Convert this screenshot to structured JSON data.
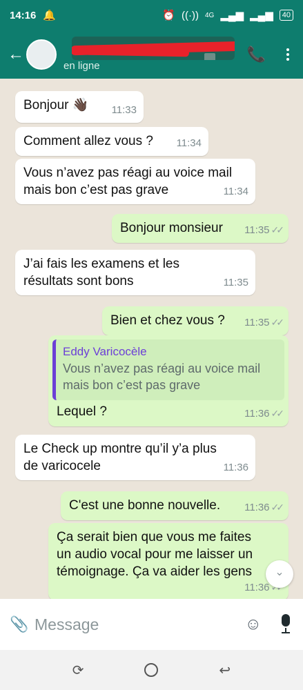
{
  "status_bar": {
    "time": "14:16",
    "notification_icon": "bell-icon",
    "network": "4G",
    "battery": "40"
  },
  "header": {
    "contact_name_visible": "en ligne",
    "contact_status": "en ligne",
    "back_icon": "arrow-left-icon",
    "call_icon": "phone-icon",
    "menu_icon": "kebab-icon"
  },
  "messages": [
    {
      "dir": "in",
      "text": "Bonjour 👋🏿",
      "time": "11:33"
    },
    {
      "dir": "in",
      "text": "Comment allez vous ?",
      "time": "11:34"
    },
    {
      "dir": "in",
      "line1": "Vous n’avez pas réagi au voice mail",
      "line2": "mais bon c’est pas grave",
      "time": "11:34"
    },
    {
      "dir": "out",
      "text": "Bonjour monsieur",
      "time": "11:35"
    },
    {
      "dir": "in",
      "line1": "J’ai fais les examens et les",
      "line2": "résultats sont bons",
      "time": "11:35"
    },
    {
      "dir": "out",
      "text": "Bien et chez vous ?",
      "time": "11:35"
    },
    {
      "dir": "out",
      "quote_author": "Eddy Varicocèle",
      "quote_line1": "Vous n’avez pas réagi au voice mail",
      "quote_line2": "mais bon c’est pas grave",
      "text": "Lequel ?",
      "time": "11:36"
    },
    {
      "dir": "in",
      "line1": "Le Check up montre qu’il y’a plus",
      "line2": "de varicocele",
      "time": "11:36"
    },
    {
      "dir": "out",
      "text": "C'est une bonne nouvelle.",
      "time": "11:36"
    },
    {
      "dir": "out",
      "line1": "Ça serait bien que vous me faites",
      "line2": "un audio vocal pour me laisser un",
      "line3": "témoignage. Ça va aider les gens",
      "time": "11:36"
    }
  ],
  "input_bar": {
    "placeholder": "Message",
    "attach_icon": "paperclip-icon",
    "emoji_icon": "emoji-icon",
    "mic_icon": "microphone-icon"
  },
  "nav_bar": {
    "recents_icon": "recents-icon",
    "home_icon": "home-icon",
    "back_icon": "nav-back-icon"
  },
  "colors": {
    "header": "#0e7d6e",
    "incoming_bubble": "#ffffff",
    "outgoing_bubble": "#dcf8c6",
    "chat_background": "#ebe4da",
    "quote_accent": "#6c3fd6",
    "redaction": "#e8222a"
  }
}
